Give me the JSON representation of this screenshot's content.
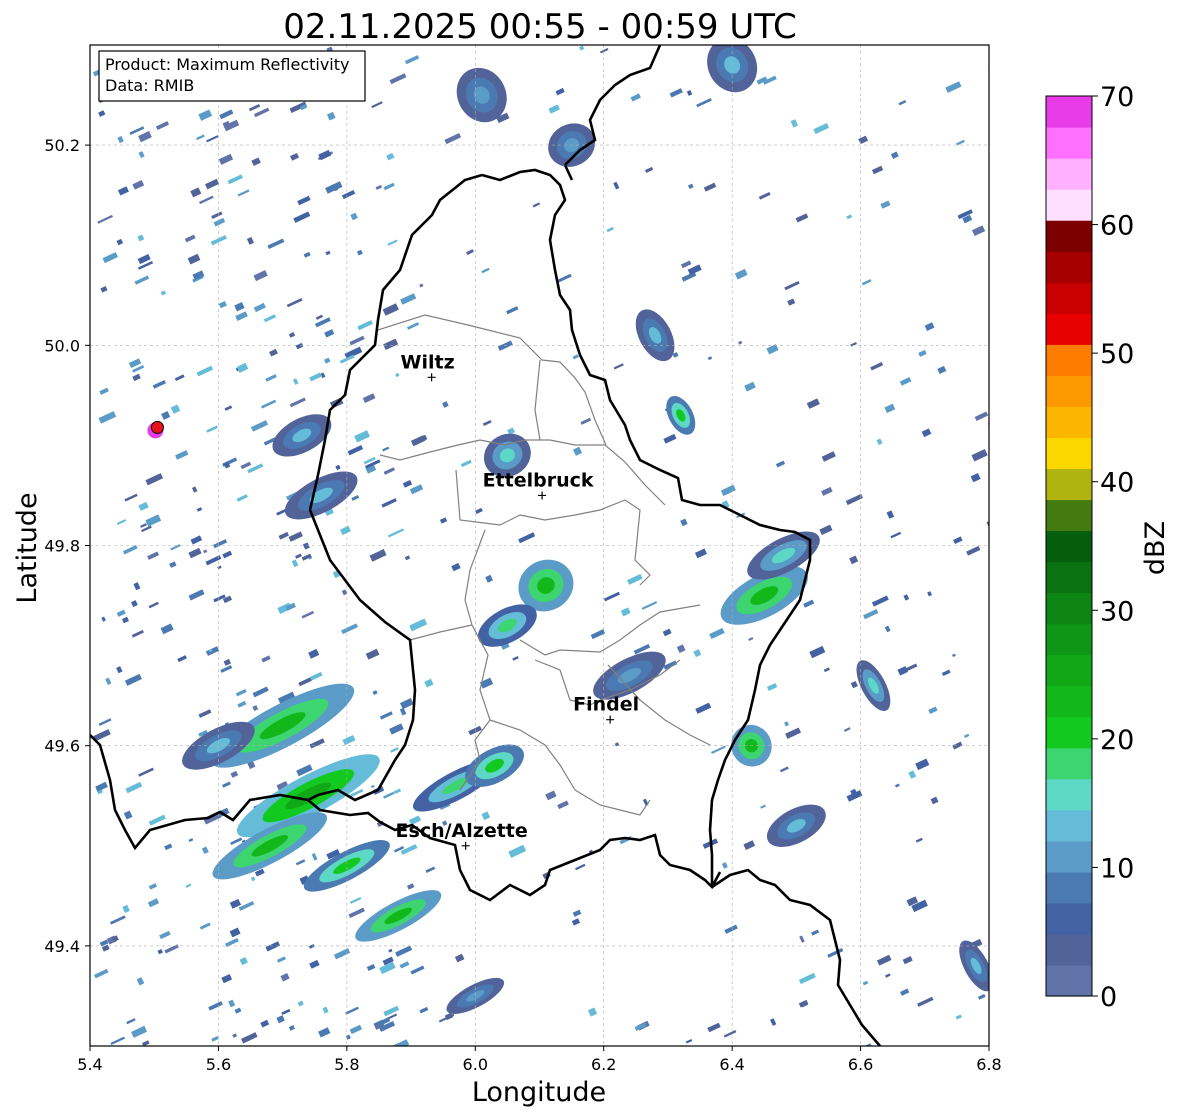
{
  "title": "02.11.2025 00:55 - 00:59 UTC",
  "info_box": {
    "product": "Product: Maximum Reflectivity",
    "source": "Data: RMIB"
  },
  "axes": {
    "xlabel": "Longitude",
    "ylabel": "Latitude",
    "xlim": [
      5.4,
      6.8
    ],
    "ylim": [
      49.3,
      50.3
    ],
    "xticks": [
      5.4,
      5.6,
      5.8,
      6.0,
      6.2,
      6.4,
      6.6,
      6.8
    ],
    "xtick_labels": [
      "5.4",
      "5.6",
      "5.8",
      "6.0",
      "6.2",
      "6.4",
      "6.6",
      "6.8"
    ],
    "yticks": [
      49.4,
      49.6,
      49.8,
      50.0,
      50.2
    ],
    "ytick_labels": [
      "49.4",
      "49.6",
      "49.8",
      "50.0",
      "50.2"
    ],
    "grid": true
  },
  "colorbar": {
    "label": "dBZ",
    "min": 0,
    "max": 70,
    "ticks": [
      0,
      10,
      20,
      30,
      40,
      50,
      60,
      70
    ],
    "tick_labels": [
      "0",
      "10",
      "20",
      "30",
      "40",
      "50",
      "60",
      "70"
    ],
    "colors": [
      "#6173a8",
      "#516399",
      "#4262a3",
      "#4b7ab2",
      "#5a9bc8",
      "#65bcd9",
      "#5ed8c6",
      "#3dd56f",
      "#11c91f",
      "#12b81a",
      "#11a818",
      "#0f9616",
      "#0d8513",
      "#0a7210",
      "#055e0c",
      "#457a10",
      "#b0b30e",
      "#fcd600",
      "#fcb600",
      "#fc9900",
      "#fc7d00",
      "#e80000",
      "#c80000",
      "#a60000",
      "#7c0000",
      "#ffdfff",
      "#ffb0ff",
      "#ff70ff",
      "#e83ce8"
    ]
  },
  "cities": [
    {
      "name": "Wiltz",
      "lon": 5.932,
      "lat": 49.968
    },
    {
      "name": "Ettelbruck",
      "lon": 6.104,
      "lat": 49.85
    },
    {
      "name": "Findel",
      "lon": 6.21,
      "lat": 49.626
    },
    {
      "name": "Esch/Alzette",
      "lon": 5.985,
      "lat": 49.5
    }
  ],
  "chart_data": {
    "type": "heatmap",
    "title": "02.11.2025 00:55 - 00:59 UTC",
    "xlabel": "Longitude",
    "ylabel": "Latitude",
    "xlim": [
      5.4,
      6.8
    ],
    "ylim": [
      49.3,
      50.3
    ],
    "colorbar_label": "dBZ",
    "value_range": [
      0,
      70
    ],
    "marker": {
      "lon": 5.505,
      "lat": 49.918,
      "color": "#e8121c"
    },
    "echo_cells": [
      {
        "lon": 5.7,
        "lat": 49.62,
        "rx": 0.1,
        "ry": 0.015,
        "dbz": 22
      },
      {
        "lon": 5.74,
        "lat": 49.55,
        "rx": 0.1,
        "ry": 0.014,
        "dbz": 26
      },
      {
        "lon": 5.68,
        "lat": 49.5,
        "rx": 0.08,
        "ry": 0.012,
        "dbz": 24
      },
      {
        "lon": 5.8,
        "lat": 49.48,
        "rx": 0.06,
        "ry": 0.01,
        "dbz": 20
      },
      {
        "lon": 5.88,
        "lat": 49.43,
        "rx": 0.06,
        "ry": 0.01,
        "dbz": 22
      },
      {
        "lon": 5.97,
        "lat": 49.56,
        "rx": 0.06,
        "ry": 0.01,
        "dbz": 18
      },
      {
        "lon": 6.03,
        "lat": 49.58,
        "rx": 0.04,
        "ry": 0.012,
        "dbz": 20
      },
      {
        "lon": 6.11,
        "lat": 49.76,
        "rx": 0.035,
        "ry": 0.018,
        "dbz": 24
      },
      {
        "lon": 6.05,
        "lat": 49.72,
        "rx": 0.04,
        "ry": 0.012,
        "dbz": 18
      },
      {
        "lon": 6.45,
        "lat": 49.75,
        "rx": 0.06,
        "ry": 0.015,
        "dbz": 22
      },
      {
        "lon": 6.48,
        "lat": 49.79,
        "rx": 0.05,
        "ry": 0.012,
        "dbz": 16
      },
      {
        "lon": 6.43,
        "lat": 49.6,
        "rx": 0.025,
        "ry": 0.015,
        "dbz": 22
      },
      {
        "lon": 6.62,
        "lat": 49.66,
        "rx": 0.015,
        "ry": 0.02,
        "dbz": 16
      },
      {
        "lon": 5.76,
        "lat": 49.85,
        "rx": 0.05,
        "ry": 0.012,
        "dbz": 14
      },
      {
        "lon": 5.73,
        "lat": 49.91,
        "rx": 0.04,
        "ry": 0.012,
        "dbz": 14
      },
      {
        "lon": 6.05,
        "lat": 49.89,
        "rx": 0.03,
        "ry": 0.015,
        "dbz": 16
      },
      {
        "lon": 6.28,
        "lat": 50.01,
        "rx": 0.02,
        "ry": 0.02,
        "dbz": 14
      },
      {
        "lon": 6.32,
        "lat": 49.93,
        "rx": 0.015,
        "ry": 0.015,
        "dbz": 20
      },
      {
        "lon": 6.01,
        "lat": 50.25,
        "rx": 0.03,
        "ry": 0.02,
        "dbz": 10
      },
      {
        "lon": 6.15,
        "lat": 50.2,
        "rx": 0.03,
        "ry": 0.015,
        "dbz": 12
      },
      {
        "lon": 6.4,
        "lat": 50.28,
        "rx": 0.03,
        "ry": 0.02,
        "dbz": 14
      },
      {
        "lon": 5.6,
        "lat": 49.6,
        "rx": 0.05,
        "ry": 0.012,
        "dbz": 14
      },
      {
        "lon": 6.24,
        "lat": 49.67,
        "rx": 0.05,
        "ry": 0.012,
        "dbz": 12
      },
      {
        "lon": 6.5,
        "lat": 49.52,
        "rx": 0.04,
        "ry": 0.012,
        "dbz": 14
      },
      {
        "lon": 6.0,
        "lat": 49.35,
        "rx": 0.04,
        "ry": 0.008,
        "dbz": 12
      },
      {
        "lon": 6.78,
        "lat": 49.38,
        "rx": 0.015,
        "ry": 0.02,
        "dbz": 14
      }
    ]
  }
}
